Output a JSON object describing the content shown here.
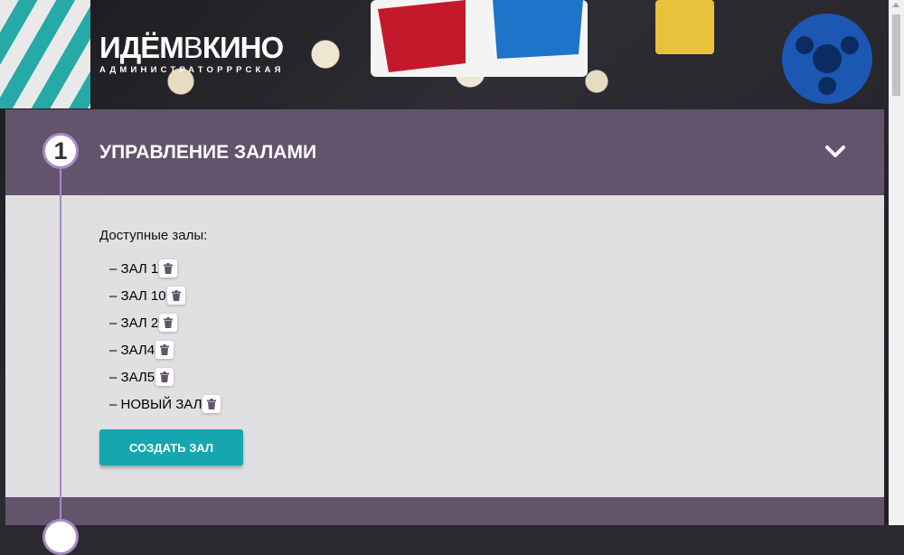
{
  "logo": {
    "title_part1": "ИДЁМ",
    "title_part2": "В",
    "title_part3": "КИНО",
    "subtitle": "АДМИНИСТРАТОРРРСКАЯ"
  },
  "section1": {
    "step": "1",
    "title": "УПРАВЛЕНИЕ ЗАЛАМИ",
    "available_label": "Доступные залы:",
    "halls": [
      {
        "label": "– ЗАЛ 1"
      },
      {
        "label": "– ЗАЛ 10"
      },
      {
        "label": "– ЗАЛ 2"
      },
      {
        "label": "– ЗАЛ4"
      },
      {
        "label": "– ЗАЛ5"
      },
      {
        "label": "– НОВЫЙ ЗАЛ"
      }
    ],
    "create_button": "СОЗДАТЬ ЗАЛ"
  },
  "colors": {
    "header": "#63536c",
    "accent": "#16a6af",
    "timeline": "#a58bc4",
    "trash": "#63536c"
  },
  "icons": {
    "collapse": "chevron-down-icon",
    "delete": "trash-icon"
  }
}
